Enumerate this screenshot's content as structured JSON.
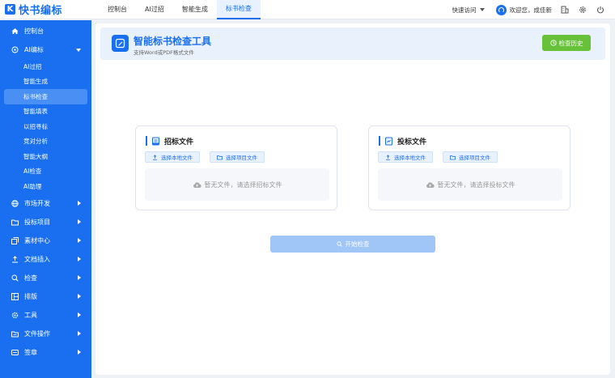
{
  "topbar": {
    "logo_mark": "K",
    "logo_text": "快书编标",
    "nav": [
      "控制台",
      "AI过招",
      "智能生成",
      "标书检查"
    ],
    "active_nav": 3,
    "quick_access": "快速访问",
    "welcome": "欢迎您，成佳新"
  },
  "sidebar": {
    "items": [
      {
        "label": "控制台",
        "icon": "home-icon",
        "arrow": "none"
      },
      {
        "label": "AI编标",
        "icon": "ai-icon",
        "arrow": "down"
      },
      {
        "label": "市场开发",
        "icon": "globe-icon",
        "arrow": "right"
      },
      {
        "label": "投标项目",
        "icon": "folder-icon",
        "arrow": "right"
      },
      {
        "label": "素材中心",
        "icon": "library-icon",
        "arrow": "right"
      },
      {
        "label": "文档插入",
        "icon": "upload-icon",
        "arrow": "right"
      },
      {
        "label": "检查",
        "icon": "search-icon",
        "arrow": "right"
      },
      {
        "label": "排版",
        "icon": "layout-icon",
        "arrow": "right"
      },
      {
        "label": "工具",
        "icon": "tool-icon",
        "arrow": "right"
      },
      {
        "label": "文件操作",
        "icon": "file-icon",
        "arrow": "right"
      },
      {
        "label": "签章",
        "icon": "stamp-icon",
        "arrow": "right"
      }
    ],
    "subitems": [
      "AI过招",
      "智能生成",
      "标书检查",
      "智能填表",
      "以招寻标",
      "竞对分析",
      "智能大纲",
      "AI检查",
      "AI助理"
    ],
    "active_sub": 2
  },
  "header": {
    "title": "智能标书检查工具",
    "subtitle": "支持Word或PDF格式文件",
    "history_button": "检查历史"
  },
  "cards": [
    {
      "title": "招标文件",
      "btn_local": "选择本地文件",
      "btn_project": "选择项目文件",
      "empty": "暂无文件，请选择招标文件"
    },
    {
      "title": "投标文件",
      "btn_local": "选择本地文件",
      "btn_project": "选择项目文件",
      "empty": "暂无文件，请选择投标文件"
    }
  ],
  "start_button": "开始检查",
  "colors": {
    "primary": "#1a6ff0",
    "success": "#67c23a",
    "disabled": "#a0c5f7"
  }
}
